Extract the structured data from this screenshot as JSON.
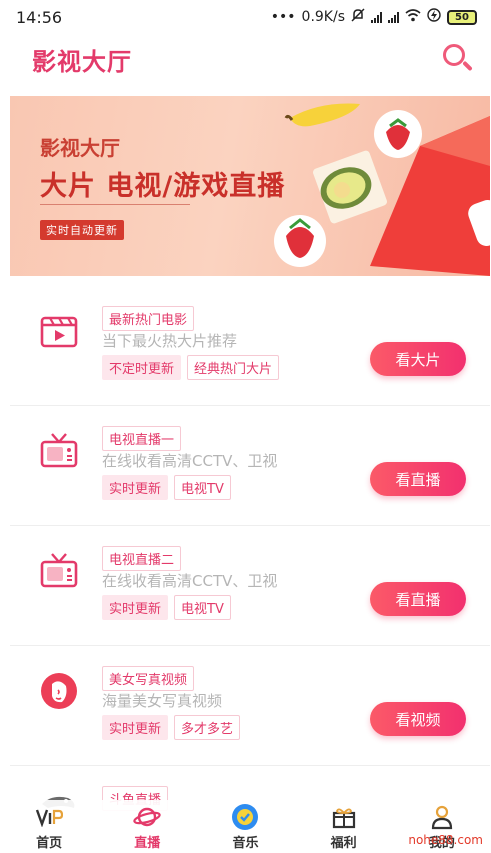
{
  "status_bar": {
    "time": "14:56",
    "dots": "•••",
    "speed": "0.9K/s",
    "battery": "50"
  },
  "header": {
    "title": "影视大厅"
  },
  "banner": {
    "small_title": "影视大厅",
    "big_title": "大片 电视/游戏直播",
    "tag": "实时自动更新"
  },
  "cards": [
    {
      "title": "最新热门电影",
      "desc": "当下最火热大片推荐",
      "tags": [
        "不定时更新",
        "经典热门大片"
      ],
      "button": "看大片",
      "icon": "movie-clapper-icon"
    },
    {
      "title": "电视直播一",
      "desc": "在线收看高清CCTV、卫视",
      "tags": [
        "实时更新",
        "电视TV"
      ],
      "button": "看直播",
      "icon": "tv-icon"
    },
    {
      "title": "电视直播二",
      "desc": "在线收看高清CCTV、卫视",
      "tags": [
        "实时更新",
        "电视TV"
      ],
      "button": "看直播",
      "icon": "tv-icon"
    },
    {
      "title": "美女写真视频",
      "desc": "海量美女写真视频",
      "tags": [
        "实时更新",
        "多才多艺"
      ],
      "button": "看视频",
      "icon": "woman-face-icon"
    },
    {
      "title": "斗鱼直播",
      "desc": "",
      "tags": [],
      "button": "",
      "icon": "douyu-fish-icon"
    }
  ],
  "nav": [
    {
      "label": "首页",
      "icon": "vip-icon"
    },
    {
      "label": "直播",
      "icon": "planet-icon",
      "active": true
    },
    {
      "label": "音乐",
      "icon": "music-icon"
    },
    {
      "label": "福利",
      "icon": "gift-icon"
    },
    {
      "label": "我的",
      "icon": "user-icon"
    }
  ],
  "watermark": "nohe88.com",
  "colors": {
    "accent": "#e33a6a",
    "button_start": "#fb5a68",
    "button_end": "#f2306f"
  }
}
